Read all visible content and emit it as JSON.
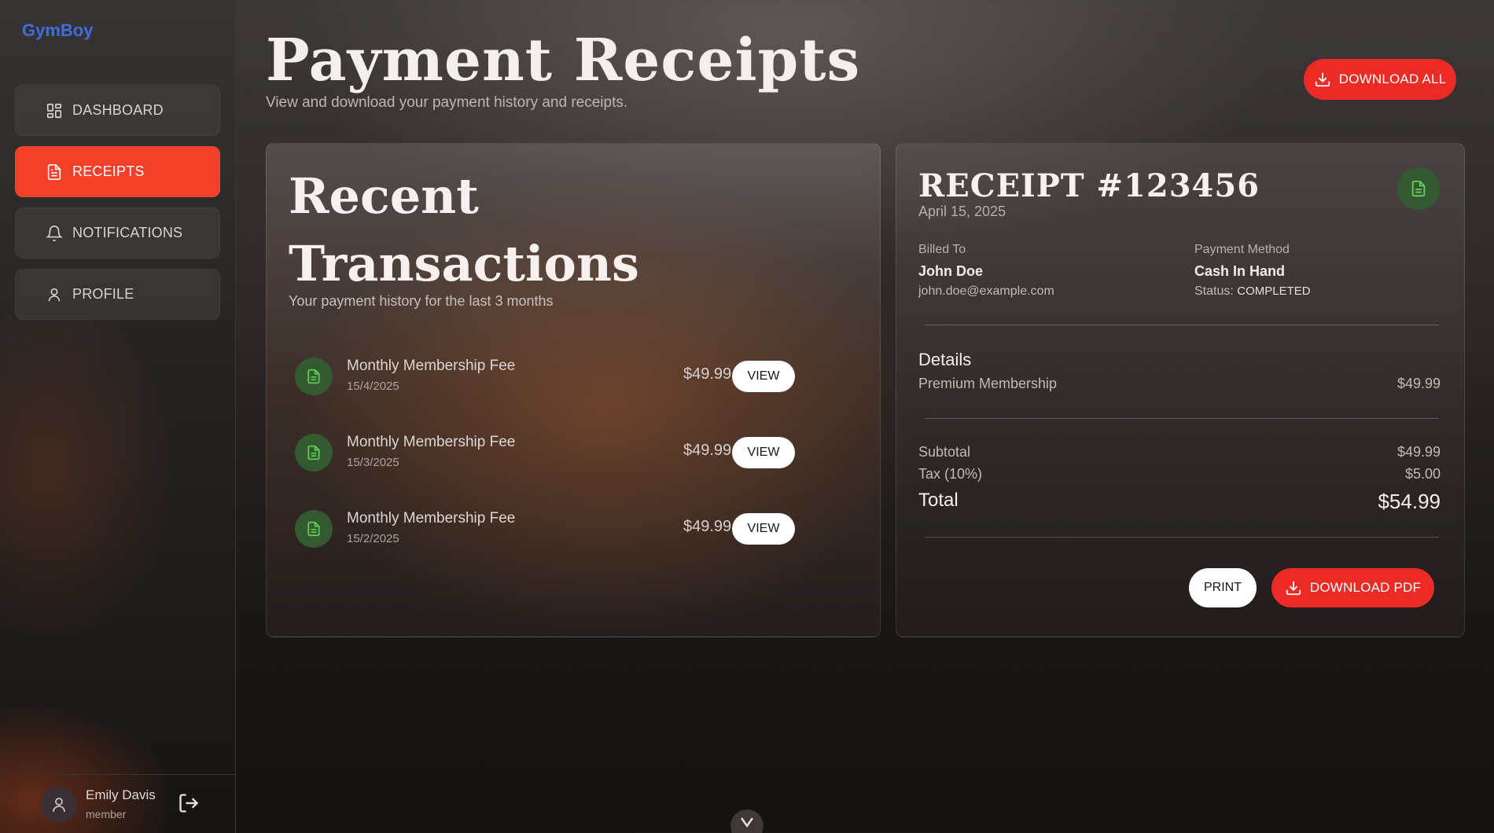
{
  "app": {
    "brand": "GymBoy"
  },
  "sidebar": {
    "items": [
      {
        "label": "DASHBOARD",
        "icon": "dashboard-icon",
        "active": false
      },
      {
        "label": "RECEIPTS",
        "icon": "receipt-icon",
        "active": true
      },
      {
        "label": "NOTIFICATIONS",
        "icon": "bell-icon",
        "active": false
      },
      {
        "label": "PROFILE",
        "icon": "user-icon",
        "active": false
      }
    ],
    "user": {
      "name": "Emily Davis",
      "role": "member"
    }
  },
  "header": {
    "title": "Payment Receipts",
    "subtitle": "View and download your payment history and receipts.",
    "download_all_label": "DOWNLOAD ALL"
  },
  "transactions": {
    "title": "Recent Transactions",
    "subtitle": "Your payment history for the last 3 months",
    "items": [
      {
        "name": "Monthly Membership Fee",
        "date": "15/4/2025",
        "amount": "$49.99",
        "action": "VIEW"
      },
      {
        "name": "Monthly Membership Fee",
        "date": "15/3/2025",
        "amount": "$49.99",
        "action": "VIEW"
      },
      {
        "name": "Monthly Membership Fee",
        "date": "15/2/2025",
        "amount": "$49.99",
        "action": "VIEW"
      }
    ]
  },
  "receipt": {
    "title": "RECEIPT #123456",
    "date": "April 15, 2025",
    "billed_to_label": "Billed To",
    "billed_to_name": "John Doe",
    "billed_to_email": "john.doe@example.com",
    "payment_method_label": "Payment Method",
    "payment_method": "Cash In Hand",
    "status_label": "Status:",
    "status": "COMPLETED",
    "details_heading": "Details",
    "line_item": "Premium Membership",
    "line_amount": "$49.99",
    "subtotal_label": "Subtotal",
    "subtotal": "$49.99",
    "tax_label": "Tax (10%)",
    "tax": "$5.00",
    "total_label": "Total",
    "total": "$54.99",
    "print_label": "PRINT",
    "download_pdf_label": "DOWNLOAD PDF"
  },
  "colors": {
    "accent_red": "#ec2a26",
    "active_nav": "#f2402b",
    "brand_blue": "#3f6de0",
    "doc_green": "#5fd15a"
  }
}
